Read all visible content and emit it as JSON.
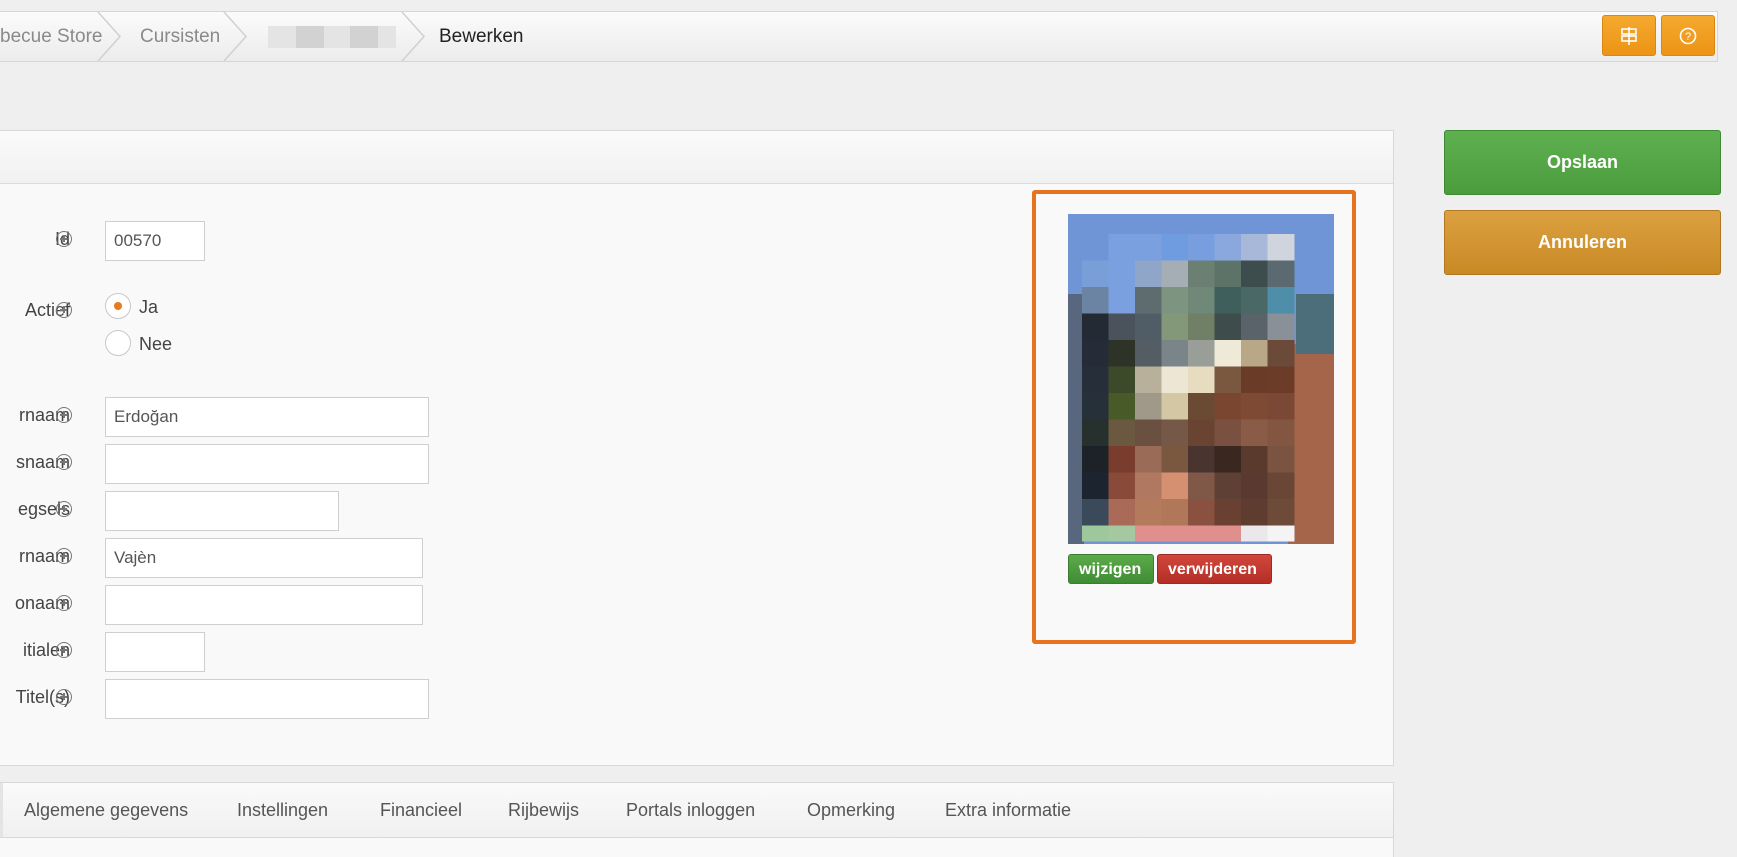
{
  "breadcrumb": {
    "items": [
      "becue Store",
      "Cursisten",
      "Bewerken"
    ]
  },
  "toolbar": {
    "icons": [
      "signpost-icon",
      "help-icon"
    ]
  },
  "form": {
    "id": {
      "label": "Id",
      "value": "00570"
    },
    "actief": {
      "label": "Actief",
      "options": [
        "Ja",
        "Nee"
      ],
      "selected": "Ja"
    },
    "roepnaam": {
      "label": "rnaam",
      "value": "Erdoğan"
    },
    "voornaam": {
      "label": "snaam",
      "value": ""
    },
    "tussenvoegsels": {
      "label": "egsels",
      "value": ""
    },
    "achternaam": {
      "label": "rnaam",
      "value": "Vajèn"
    },
    "geboortenaam": {
      "label": "onaam",
      "value": ""
    },
    "initialen": {
      "label": "itialen",
      "value": ""
    },
    "titels": {
      "label": "Titel(s)",
      "value": ""
    }
  },
  "photo": {
    "change_label": "wijzigen",
    "delete_label": "verwijderen"
  },
  "actions": {
    "save_label": "Opslaan",
    "cancel_label": "Annuleren"
  },
  "tabs": [
    "Algemene gegevens",
    "Instellingen",
    "Financieel",
    "Rijbewijs",
    "Portals inloggen",
    "Opmerking",
    "Extra informatie"
  ],
  "colors": {
    "accent_orange": "#e8731f",
    "save_green": "#4fa241",
    "cancel_gold": "#cf9230",
    "delete_red": "#c13a31"
  }
}
